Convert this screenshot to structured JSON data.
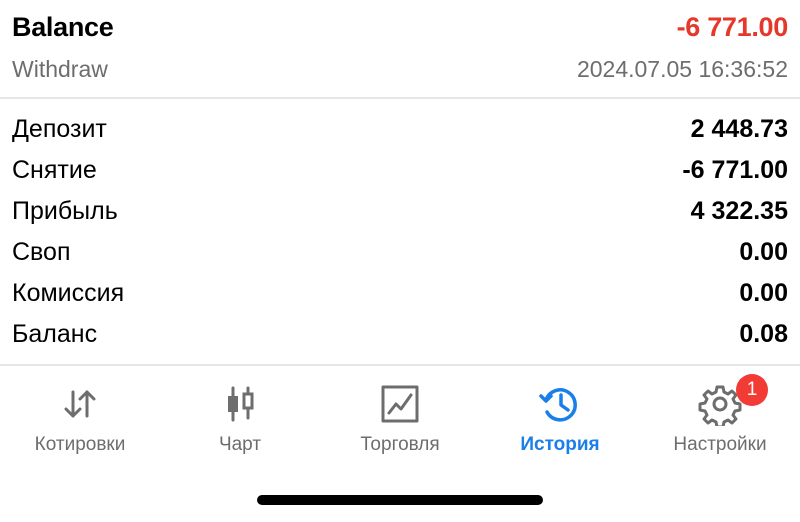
{
  "header": {
    "title": "Balance",
    "amount": "-6 771.00",
    "amount_color": "#e5382a",
    "subtitle": "Withdraw",
    "timestamp": "2024.07.05 16:36:52"
  },
  "details": [
    {
      "label": "Депозит",
      "value": "2 448.73"
    },
    {
      "label": "Снятие",
      "value": "-6 771.00"
    },
    {
      "label": "Прибыль",
      "value": "4 322.35"
    },
    {
      "label": "Своп",
      "value": "0.00"
    },
    {
      "label": "Комиссия",
      "value": "0.00"
    },
    {
      "label": "Баланс",
      "value": "0.08"
    }
  ],
  "tabs": [
    {
      "label": "Котировки",
      "icon": "quotes-arrows-icon",
      "active": false
    },
    {
      "label": "Чарт",
      "icon": "candlestick-chart-icon",
      "active": false
    },
    {
      "label": "Торговля",
      "icon": "trade-chart-icon",
      "active": false
    },
    {
      "label": "История",
      "icon": "history-clock-icon",
      "active": true
    },
    {
      "label": "Настройки",
      "icon": "gear-icon",
      "active": false,
      "badge": "1"
    }
  ],
  "colors": {
    "accent": "#1a7fe8",
    "inactive_icon": "#6d6d6d",
    "badge": "#f23b35",
    "divider": "#e6e6e6"
  }
}
